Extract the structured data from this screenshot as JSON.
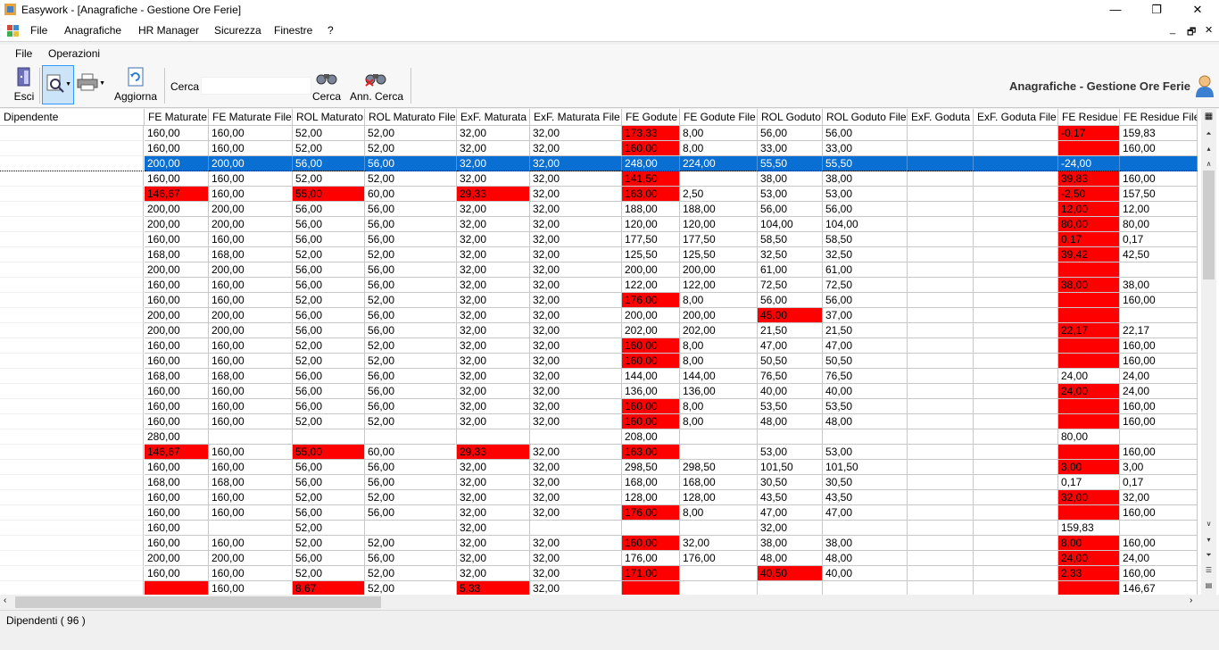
{
  "window": {
    "title": "Easywork - [Anagrafiche - Gestione Ore Ferie]",
    "minimize_glyph": "—",
    "restore_glyph": "❐",
    "close_glyph": "✕"
  },
  "menubar": {
    "items": [
      "File",
      "Anagrafiche",
      "HR Manager",
      "Sicurezza",
      "Finestre",
      "?"
    ],
    "mdi_minimize": "_",
    "mdi_restore": "🗗",
    "mdi_close": "✕"
  },
  "submenu": {
    "items": [
      "File",
      "Operazioni"
    ]
  },
  "toolbar": {
    "exit_label": "Esci",
    "refresh_label": "Aggiorna",
    "search_label": "Cerca",
    "search_value": "",
    "find_label": "Cerca",
    "cancel_find_label": "Ann. Cerca",
    "view_title": "Anagrafiche - Gestione Ore Ferie"
  },
  "colors": {
    "alert": "#ff0000",
    "selection": "#0a6fd3"
  },
  "grid": {
    "first_column": "Dipendente",
    "columns": [
      "FE Maturate",
      "FE Maturate File",
      "ROL Maturato",
      "ROL Maturato File",
      "ExF. Maturata",
      "ExF. Maturata File",
      "FE Godute",
      "FE Godute File",
      "ROL Goduto",
      "ROL Goduto File",
      "ExF. Goduta",
      "ExF. Goduta File",
      "FE Residue",
      "FE Residue File"
    ],
    "selected_row": 2,
    "rows": [
      {
        "v": [
          "160,00",
          "160,00",
          "52,00",
          "52,00",
          "32,00",
          "32,00",
          "173,33",
          "8,00",
          "56,00",
          "56,00",
          "",
          "",
          "-0,17",
          "159,83"
        ],
        "r": [
          6,
          12
        ]
      },
      {
        "v": [
          "160,00",
          "160,00",
          "52,00",
          "52,00",
          "32,00",
          "32,00",
          "160,00",
          "8,00",
          "33,00",
          "33,00",
          "",
          "",
          "",
          "160,00"
        ],
        "r": [
          6,
          12
        ]
      },
      {
        "v": [
          "200,00",
          "200,00",
          "56,00",
          "56,00",
          "32,00",
          "32,00",
          "248,00",
          "224,00",
          "55,50",
          "55,50",
          "",
          "",
          "-24,00",
          ""
        ],
        "r": []
      },
      {
        "v": [
          "160,00",
          "160,00",
          "52,00",
          "52,00",
          "32,00",
          "32,00",
          "141,50",
          "",
          "38,00",
          "38,00",
          "",
          "",
          "39,83",
          "160,00"
        ],
        "r": [
          6,
          12
        ]
      },
      {
        "v": [
          "146,67",
          "160,00",
          "55,00",
          "60,00",
          "29,33",
          "32,00",
          "163,00",
          "2,50",
          "53,00",
          "53,00",
          "",
          "",
          "-2,50",
          "157,50"
        ],
        "r": [
          0,
          2,
          4,
          6,
          12
        ]
      },
      {
        "v": [
          "200,00",
          "200,00",
          "56,00",
          "56,00",
          "32,00",
          "32,00",
          "188,00",
          "188,00",
          "56,00",
          "56,00",
          "",
          "",
          "12,00",
          "12,00"
        ],
        "r": [
          12
        ]
      },
      {
        "v": [
          "200,00",
          "200,00",
          "56,00",
          "56,00",
          "32,00",
          "32,00",
          "120,00",
          "120,00",
          "104,00",
          "104,00",
          "",
          "",
          "80,00",
          "80,00"
        ],
        "r": [
          12
        ]
      },
      {
        "v": [
          "160,00",
          "160,00",
          "56,00",
          "56,00",
          "32,00",
          "32,00",
          "177,50",
          "177,50",
          "58,50",
          "58,50",
          "",
          "",
          "0,17",
          "0,17"
        ],
        "r": [
          12
        ]
      },
      {
        "v": [
          "168,00",
          "168,00",
          "52,00",
          "52,00",
          "32,00",
          "32,00",
          "125,50",
          "125,50",
          "32,50",
          "32,50",
          "",
          "",
          "39,42",
          "42,50"
        ],
        "r": [
          12
        ]
      },
      {
        "v": [
          "200,00",
          "200,00",
          "56,00",
          "56,00",
          "32,00",
          "32,00",
          "200,00",
          "200,00",
          "61,00",
          "61,00",
          "",
          "",
          "",
          ""
        ],
        "r": [
          12
        ]
      },
      {
        "v": [
          "160,00",
          "160,00",
          "56,00",
          "56,00",
          "32,00",
          "32,00",
          "122,00",
          "122,00",
          "72,50",
          "72,50",
          "",
          "",
          "38,00",
          "38,00"
        ],
        "r": [
          12
        ]
      },
      {
        "v": [
          "160,00",
          "160,00",
          "52,00",
          "52,00",
          "32,00",
          "32,00",
          "176,00",
          "8,00",
          "56,00",
          "56,00",
          "",
          "",
          "",
          "160,00"
        ],
        "r": [
          6,
          12
        ]
      },
      {
        "v": [
          "200,00",
          "200,00",
          "56,00",
          "56,00",
          "32,00",
          "32,00",
          "200,00",
          "200,00",
          "45,00",
          "37,00",
          "",
          "",
          "",
          ""
        ],
        "r": [
          8,
          12
        ]
      },
      {
        "v": [
          "200,00",
          "200,00",
          "56,00",
          "56,00",
          "32,00",
          "32,00",
          "202,00",
          "202,00",
          "21,50",
          "21,50",
          "",
          "",
          "22,17",
          "22,17"
        ],
        "r": [
          12
        ]
      },
      {
        "v": [
          "160,00",
          "160,00",
          "52,00",
          "52,00",
          "32,00",
          "32,00",
          "160,00",
          "8,00",
          "47,00",
          "47,00",
          "",
          "",
          "",
          "160,00"
        ],
        "r": [
          6,
          12
        ]
      },
      {
        "v": [
          "160,00",
          "160,00",
          "52,00",
          "52,00",
          "32,00",
          "32,00",
          "160,00",
          "8,00",
          "50,50",
          "50,50",
          "",
          "",
          "",
          "160,00"
        ],
        "r": [
          6,
          12
        ]
      },
      {
        "v": [
          "168,00",
          "168,00",
          "56,00",
          "56,00",
          "32,00",
          "32,00",
          "144,00",
          "144,00",
          "76,50",
          "76,50",
          "",
          "",
          "24,00",
          "24,00"
        ],
        "r": []
      },
      {
        "v": [
          "160,00",
          "160,00",
          "56,00",
          "56,00",
          "32,00",
          "32,00",
          "136,00",
          "136,00",
          "40,00",
          "40,00",
          "",
          "",
          "24,00",
          "24,00"
        ],
        "r": [
          12
        ]
      },
      {
        "v": [
          "160,00",
          "160,00",
          "56,00",
          "56,00",
          "32,00",
          "32,00",
          "160,00",
          "8,00",
          "53,50",
          "53,50",
          "",
          "",
          "",
          "160,00"
        ],
        "r": [
          6,
          12
        ]
      },
      {
        "v": [
          "160,00",
          "160,00",
          "52,00",
          "52,00",
          "32,00",
          "32,00",
          "160,00",
          "8,00",
          "48,00",
          "48,00",
          "",
          "",
          "",
          "160,00"
        ],
        "r": [
          6,
          12
        ]
      },
      {
        "v": [
          "280,00",
          "",
          "",
          "",
          "",
          "",
          "208,00",
          "",
          "",
          "",
          "",
          "",
          "80,00",
          ""
        ],
        "r": []
      },
      {
        "v": [
          "146,67",
          "160,00",
          "55,00",
          "60,00",
          "29,33",
          "32,00",
          "163,00",
          "",
          "53,00",
          "53,00",
          "",
          "",
          "",
          "160,00"
        ],
        "r": [
          0,
          2,
          4,
          6,
          12
        ]
      },
      {
        "v": [
          "160,00",
          "160,00",
          "56,00",
          "56,00",
          "32,00",
          "32,00",
          "298,50",
          "298,50",
          "101,50",
          "101,50",
          "",
          "",
          "3,00",
          "3,00"
        ],
        "r": [
          12
        ]
      },
      {
        "v": [
          "168,00",
          "168,00",
          "56,00",
          "56,00",
          "32,00",
          "32,00",
          "168,00",
          "168,00",
          "30,50",
          "30,50",
          "",
          "",
          "0,17",
          "0,17"
        ],
        "r": []
      },
      {
        "v": [
          "160,00",
          "160,00",
          "52,00",
          "52,00",
          "32,00",
          "32,00",
          "128,00",
          "128,00",
          "43,50",
          "43,50",
          "",
          "",
          "32,00",
          "32,00"
        ],
        "r": [
          12
        ]
      },
      {
        "v": [
          "160,00",
          "160,00",
          "56,00",
          "56,00",
          "32,00",
          "32,00",
          "176,00",
          "8,00",
          "47,00",
          "47,00",
          "",
          "",
          "",
          "160,00"
        ],
        "r": [
          6,
          12
        ]
      },
      {
        "v": [
          "160,00",
          "",
          "52,00",
          "",
          "32,00",
          "",
          "",
          "",
          "32,00",
          "",
          "",
          "",
          "159,83",
          ""
        ],
        "r": []
      },
      {
        "v": [
          "160,00",
          "160,00",
          "52,00",
          "52,00",
          "32,00",
          "32,00",
          "160,00",
          "32,00",
          "38,00",
          "38,00",
          "",
          "",
          "8,00",
          "160,00"
        ],
        "r": [
          6,
          12
        ]
      },
      {
        "v": [
          "200,00",
          "200,00",
          "56,00",
          "56,00",
          "32,00",
          "32,00",
          "176,00",
          "176,00",
          "48,00",
          "48,00",
          "",
          "",
          "24,00",
          "24,00"
        ],
        "r": [
          12
        ]
      },
      {
        "v": [
          "160,00",
          "160,00",
          "52,00",
          "52,00",
          "32,00",
          "32,00",
          "171,00",
          "",
          "40,50",
          "40,00",
          "",
          "",
          "2,33",
          "160,00"
        ],
        "r": [
          6,
          8,
          12
        ]
      },
      {
        "v": [
          "",
          "160,00",
          "8,67",
          "52,00",
          "5,33",
          "32,00",
          "",
          "",
          "",
          "",
          "",
          "",
          "",
          "146,67"
        ],
        "r": [
          0,
          2,
          4,
          6,
          12
        ]
      }
    ]
  },
  "status": {
    "text": "Dipendenti ( 96 )"
  }
}
